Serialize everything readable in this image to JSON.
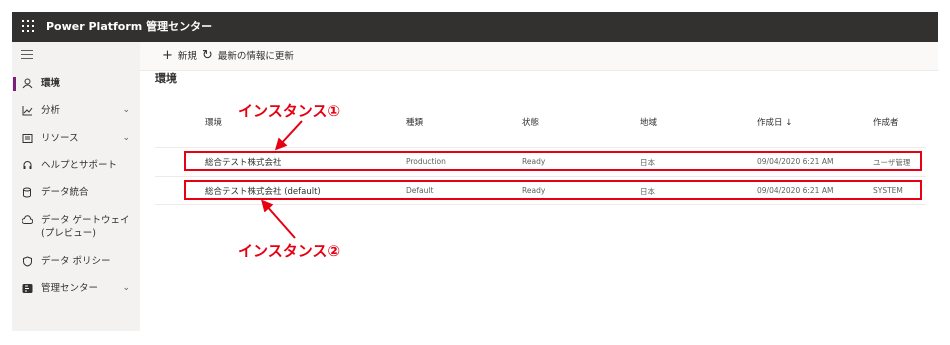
{
  "header": {
    "title": "Power Platform 管理センター"
  },
  "sidebar": {
    "items": [
      {
        "label": "環境",
        "icon": "environment-icon",
        "expandable": false,
        "active": true
      },
      {
        "label": "分析",
        "icon": "analytics-icon",
        "expandable": true
      },
      {
        "label": "リソース",
        "icon": "resources-icon",
        "expandable": true
      },
      {
        "label": "ヘルプとサポート",
        "icon": "help-support-icon",
        "expandable": false
      },
      {
        "label": "データ統合",
        "icon": "data-integration-icon",
        "expandable": false
      },
      {
        "label": "データ ゲートウェイ (プレビュー)",
        "icon": "gateway-icon",
        "expandable": false
      },
      {
        "label": "データ ポリシー",
        "icon": "shield-icon",
        "expandable": false
      },
      {
        "label": "管理センター",
        "icon": "admin-center-icon",
        "expandable": true
      }
    ]
  },
  "commandbar": {
    "new_label": "新規",
    "refresh_label": "最新の情報に更新"
  },
  "main": {
    "title": "環境"
  },
  "table": {
    "columns": [
      "環境",
      "種類",
      "状態",
      "地域",
      "作成日 ↓",
      "作成者"
    ],
    "rows": [
      {
        "name": "総合テスト株式会社",
        "type": "Production",
        "state": "Ready",
        "region": "日本",
        "created": "09/04/2020 6:21 AM",
        "creator": "ユーザ管理"
      },
      {
        "name": "総合テスト株式会社 (default)",
        "type": "Default",
        "state": "Ready",
        "region": "日本",
        "created": "09/04/2020 6:21 AM",
        "creator": "SYSTEM"
      }
    ]
  },
  "annotations": {
    "callout1": "インスタンス①",
    "callout2": "インスタンス②",
    "color": "#e60012"
  },
  "colors": {
    "header_bg": "#323130",
    "active_indicator": "#7a1f7a"
  }
}
